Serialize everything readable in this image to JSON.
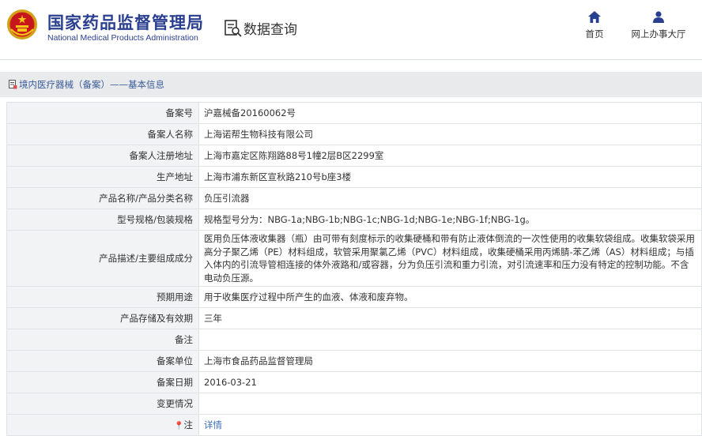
{
  "header": {
    "title_cn": "国家药品监督管理局",
    "title_en": "National Medical Products Administration",
    "section_title": "数据查询",
    "nav": {
      "home_label": "首页",
      "office_label": "网上办事大厅"
    }
  },
  "breadcrumb": {
    "text": "境内医疗器械（备案）——基本信息"
  },
  "details": {
    "rows": [
      {
        "label": "备案号",
        "value": "沪嘉械备20160062号"
      },
      {
        "label": "备案人名称",
        "value": "上海诺帮生物科技有限公司"
      },
      {
        "label": "备案人注册地址",
        "value": "上海市嘉定区陈翔路88号1幢2层B区2299室"
      },
      {
        "label": "生产地址",
        "value": "上海市浦东新区宣秋路210号b座3楼"
      },
      {
        "label": "产品名称/产品分类名称",
        "value": "负压引流器"
      },
      {
        "label": "型号规格/包装规格",
        "value": "规格型号分为：NBG-1a;NBG-1b;NBG-1c;NBG-1d;NBG-1e;NBG-1f;NBG-1g。"
      },
      {
        "label": "产品描述/主要组成成分",
        "value": "医用负压体液收集器（瓶）由可带有刻度标示的收集硬桶和带有防止液体倒流的一次性使用的收集软袋组成。收集软袋采用高分子聚乙烯（PE）材料组成，软管采用聚氯乙烯（PVC）材料组成，收集硬桶采用丙烯腈-苯乙烯（AS）材料组成；与插入体内的引流导管相连接的体外液路和/或容器，分为负压引流和重力引流，对引流速率和压力没有特定的控制功能。不含电动负压源。"
      },
      {
        "label": "预期用途",
        "value": "用于收集医疗过程中所产生的血液、体液和废弃物。"
      },
      {
        "label": "产品存储及有效期",
        "value": "三年"
      },
      {
        "label": "备注",
        "value": ""
      },
      {
        "label": "备案单位",
        "value": "上海市食品药品监督管理局"
      },
      {
        "label": "备案日期",
        "value": "2016-03-21"
      },
      {
        "label": "变更情况",
        "value": ""
      },
      {
        "label": "注",
        "value": "详情"
      }
    ]
  },
  "colors": {
    "brand": "#2a3f8f",
    "link": "#3b6fb6",
    "label_bg": "#f2f3f5",
    "breadcrumb_bg": "#e8eaec"
  },
  "icons": [
    "emblem-icon",
    "data-query-icon",
    "home-icon",
    "user-icon",
    "document-icon",
    "pin-icon"
  ]
}
